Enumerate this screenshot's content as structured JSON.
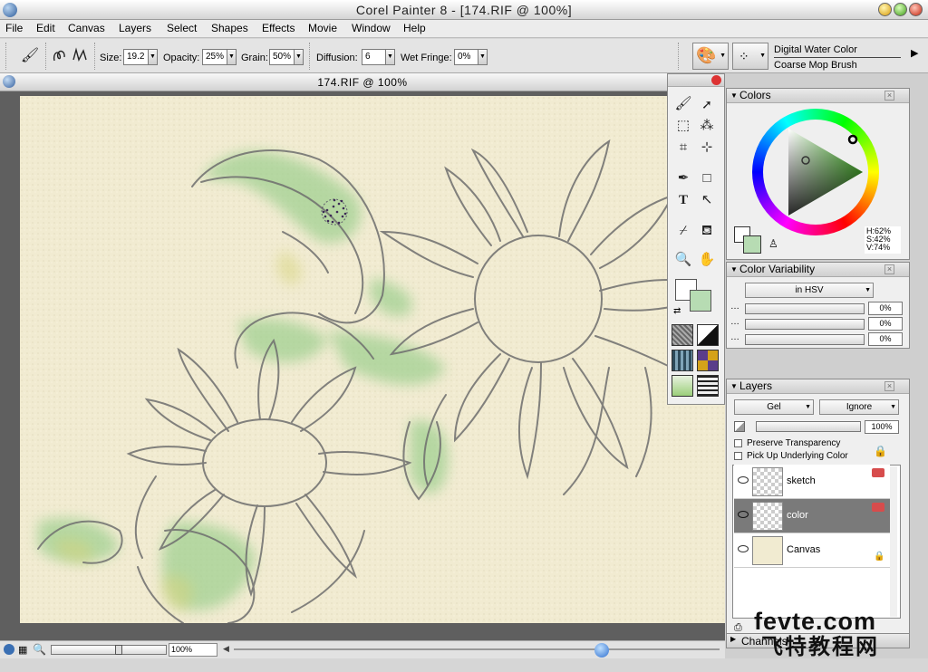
{
  "app": {
    "title": "Corel Painter 8 - [174.RIF @ 100%]"
  },
  "menu": [
    "File",
    "Edit",
    "Canvas",
    "Layers",
    "Select",
    "Shapes",
    "Effects",
    "Movie",
    "Window",
    "Help"
  ],
  "props": {
    "size_label": "Size:",
    "size_value": "19.2",
    "opacity_label": "Opacity:",
    "opacity_value": "25%",
    "grain_label": "Grain:",
    "grain_value": "50%",
    "diffusion_label": "Diffusion:",
    "diffusion_value": "6",
    "wetfringe_label": "Wet Fringe:",
    "wetfringe_value": "0%",
    "brush_category": "Digital Water Color",
    "brush_variant": "Coarse Mop Brush"
  },
  "document": {
    "title": "174.RIF @ 100%",
    "zoom": "100%"
  },
  "colors": {
    "title": "Colors",
    "h": "H:62%",
    "s": "S:42%",
    "v": "V:74%",
    "main_color": "#b7dcb3",
    "additional_color": "#ffffff"
  },
  "variability": {
    "title": "Color Variability",
    "mode": "in HSV",
    "values": [
      "0%",
      "0%",
      "0%"
    ]
  },
  "layers": {
    "title": "Layers",
    "composite_method": "Gel",
    "depth": "Ignore",
    "opacity": "100%",
    "preserve_transparency": "Preserve Transparency",
    "pick_up_underlying": "Pick Up Underlying Color",
    "items": [
      {
        "name": "sketch",
        "selected": false
      },
      {
        "name": "color",
        "selected": true
      },
      {
        "name": "Canvas",
        "selected": false
      }
    ]
  },
  "channels": {
    "title": "Channels"
  },
  "watermark": {
    "text1": "fevte.com",
    "text2": "飞特教程网"
  }
}
